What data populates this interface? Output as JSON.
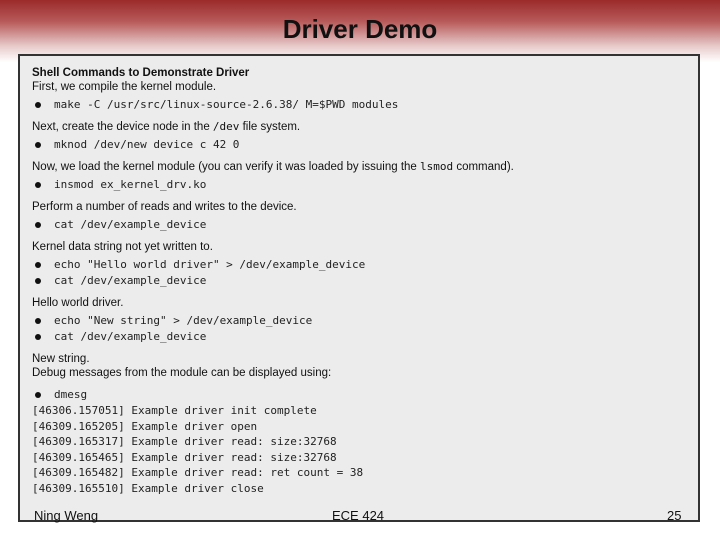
{
  "slide": {
    "title": "Driver Demo",
    "panel": {
      "heading": "Shell Commands to Demonstrate Driver",
      "intro": "First, we compile the kernel module.",
      "cmd_make": "make -C /usr/src/linux-source-2.6.38/ M=$PWD modules",
      "node_before": "Next, create the device node in the ",
      "node_code": "/dev",
      "node_after": " file system.",
      "cmd_mknod": "mknod /dev/new device c 42 0",
      "load_before": "Now, we load the kernel module (you can verify it was loaded by issuing the ",
      "load_code": "lsmod",
      "load_after": " command).",
      "cmd_insmod": "insmod ex_kernel_drv.ko",
      "rw_text": "Perform a number of reads and writes to the device.",
      "cmd_cat1": "cat /dev/example_device",
      "kernel_text": "Kernel data string not yet written to.",
      "cmd_echo1": "echo \"Hello world driver\" > /dev/example_device",
      "cmd_cat2": "cat /dev/example_device",
      "hello_text": "Hello world driver.",
      "cmd_echo2": "echo \"New string\" > /dev/example_device",
      "cmd_cat3": "cat /dev/example_device",
      "new_text": "New string.",
      "debug_text": "Debug messages from the module can be displayed using:",
      "cmd_dmesg": "dmesg",
      "log": [
        "[46306.157051] Example driver init complete",
        "[46309.165205] Example driver open",
        "[46309.165317] Example driver read: size:32768",
        "[46309.165465] Example driver read: size:32768",
        "[46309.165482] Example driver read: ret count = 38",
        "[46309.165510] Example driver close"
      ]
    },
    "footer": {
      "author": "Ning Weng",
      "course": "ECE 424",
      "page": "25"
    }
  }
}
